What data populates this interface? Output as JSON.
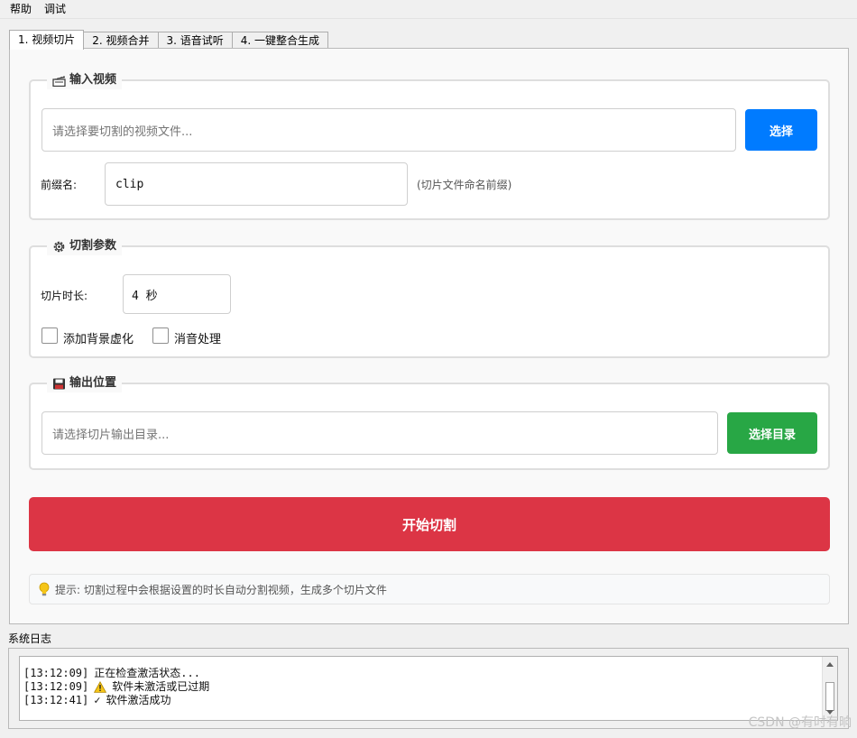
{
  "menu": {
    "items": [
      "帮助",
      "调试"
    ]
  },
  "tabs": [
    {
      "label": "1. 视频切片",
      "active": true
    },
    {
      "label": "2. 视频合并",
      "active": false
    },
    {
      "label": "3. 语音试听",
      "active": false
    },
    {
      "label": "4. 一键整合生成",
      "active": false
    }
  ],
  "input_group": {
    "title": "输入视频",
    "icon": "clapperboard-icon",
    "file_placeholder": "请选择要切割的视频文件...",
    "select_button": "选择",
    "prefix_label": "前缀名:",
    "prefix_value": "clip",
    "prefix_hint": "(切片文件命名前缀)"
  },
  "params_group": {
    "title": "切割参数",
    "icon": "gear-icon",
    "duration_label": "切片时长:",
    "duration_value": "4 秒",
    "blur_label": "添加背景虚化",
    "blur_checked": false,
    "mute_label": "消音处理",
    "mute_checked": false
  },
  "output_group": {
    "title": "输出位置",
    "icon": "floppy-disk-icon",
    "dir_placeholder": "请选择切片输出目录...",
    "select_dir_button": "选择目录"
  },
  "start_button": "开始切割",
  "tip": "提示: 切割过程中会根据设置的时长自动分割视频，生成多个切片文件",
  "log": {
    "title": "系统日志",
    "lines": [
      {
        "time": "[13:12:09]",
        "text": "正在检查激活状态...",
        "icon": ""
      },
      {
        "time": "[13:12:09]",
        "text": "软件未激活或已过期",
        "icon": "warning-icon"
      },
      {
        "time": "[13:12:41]",
        "text": "软件激活成功",
        "icon": "check-icon",
        "mark": "✓"
      }
    ]
  },
  "watermark": "CSDN @有时有晌",
  "colors": {
    "select_button": "#007bff",
    "select_dir_button": "#28a745",
    "start_button": "#dc3545"
  }
}
